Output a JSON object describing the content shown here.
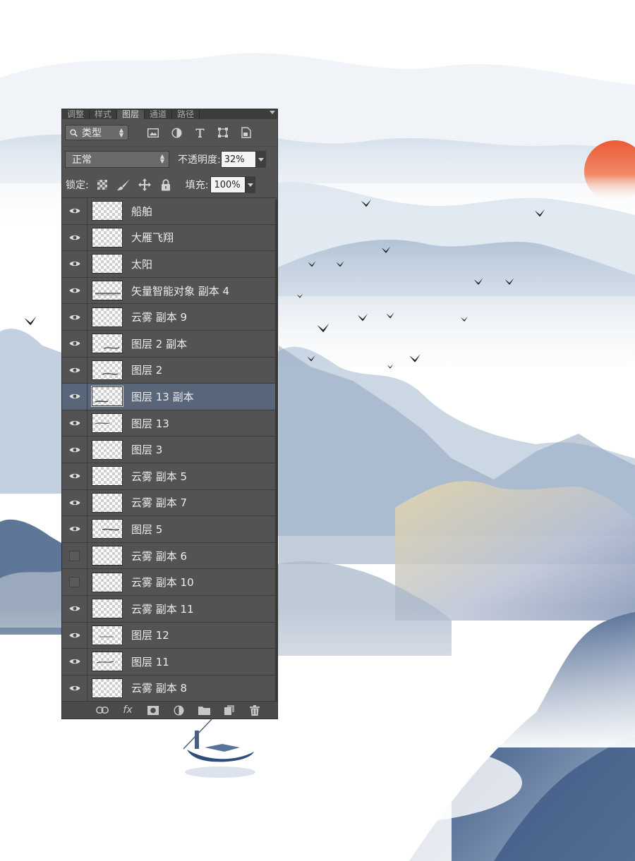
{
  "panel": {
    "tabs": [
      {
        "label": "调整"
      },
      {
        "label": "样式"
      },
      {
        "label": "图层",
        "active": true
      },
      {
        "label": "通道"
      },
      {
        "label": "路径"
      }
    ],
    "filter_kind": "类型",
    "blend_mode": "正常",
    "opacity_label": "不透明度:",
    "opacity_value": "32%",
    "lock_label": "锁定:",
    "fill_label": "填充:",
    "fill_value": "100%",
    "layers": [
      {
        "name": "船舶",
        "visible": true,
        "selected": false
      },
      {
        "name": "大雁飞翔",
        "visible": true,
        "selected": false
      },
      {
        "name": "太阳",
        "visible": true,
        "selected": false
      },
      {
        "name": "矢量智能对象 副本 4",
        "visible": true,
        "selected": false
      },
      {
        "name": "云雾 副本 9",
        "visible": true,
        "selected": false
      },
      {
        "name": "图层 2 副本",
        "visible": true,
        "selected": false
      },
      {
        "name": "图层 2",
        "visible": true,
        "selected": false
      },
      {
        "name": "图层 13 副本",
        "visible": true,
        "selected": true
      },
      {
        "name": "图层 13",
        "visible": true,
        "selected": false
      },
      {
        "name": "图层 3",
        "visible": true,
        "selected": false
      },
      {
        "name": "云雾 副本 5",
        "visible": true,
        "selected": false
      },
      {
        "name": "云雾 副本 7",
        "visible": true,
        "selected": false
      },
      {
        "name": "图层 5",
        "visible": true,
        "selected": false
      },
      {
        "name": "云雾 副本 6",
        "visible": false,
        "selected": false
      },
      {
        "name": "云雾 副本 10",
        "visible": false,
        "selected": false
      },
      {
        "name": "云雾 副本 11",
        "visible": true,
        "selected": false
      },
      {
        "name": "图层 12",
        "visible": true,
        "selected": false
      },
      {
        "name": "图层 11",
        "visible": true,
        "selected": false
      },
      {
        "name": "云雾 副本 8",
        "visible": true,
        "selected": false
      }
    ],
    "filter_icons": [
      "image-filter-icon",
      "adjustment-filter-icon",
      "type-filter-icon",
      "shape-filter-icon",
      "smart-object-filter-icon"
    ],
    "lock_icons": [
      "lock-transparent-icon",
      "lock-pixels-icon",
      "lock-position-icon",
      "lock-all-icon"
    ],
    "bottom_icons": [
      "link-layers-icon",
      "fx-icon",
      "add-mask-icon",
      "new-adjustment-icon",
      "new-group-icon",
      "new-layer-icon",
      "delete-layer-icon"
    ],
    "fx_text": "fx"
  },
  "colors": {
    "panel_bg": "#535353",
    "selected_row": "#596578",
    "sun": "#ea5a35",
    "mountain_blue": "#3e5a85"
  }
}
